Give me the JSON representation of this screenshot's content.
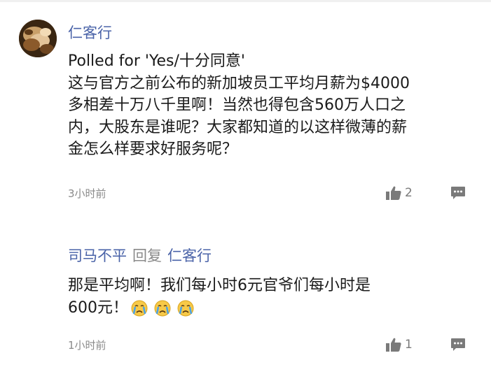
{
  "comments": [
    {
      "author": "仁客行",
      "lines": [
        "Polled for 'Yes/十分同意'",
        "这与官方之前公布的新加坡员工平均月薪为$4000",
        "多相差十万八千里啊！当然也得包含560万人口之",
        "内，大股东是谁呢？大家都知道的以这样微薄的薪",
        "金怎么样要求好服务呢？"
      ],
      "time": "3小时前",
      "likes": "2"
    }
  ],
  "reply": {
    "author": "司马不平",
    "verb": "回复",
    "target": "仁客行",
    "lines": [
      "那是平均啊！我们每小时6元官爷们每小时是",
      "600元！"
    ],
    "emojis": [
      "crying-face",
      "crying-face",
      "crying-face"
    ],
    "time": "1小时前",
    "likes": "1"
  },
  "colors": {
    "author_link": "#4a63a8",
    "text": "#1a1a1a",
    "meta": "#8a8a8a",
    "icon": "#7a7a7a"
  }
}
